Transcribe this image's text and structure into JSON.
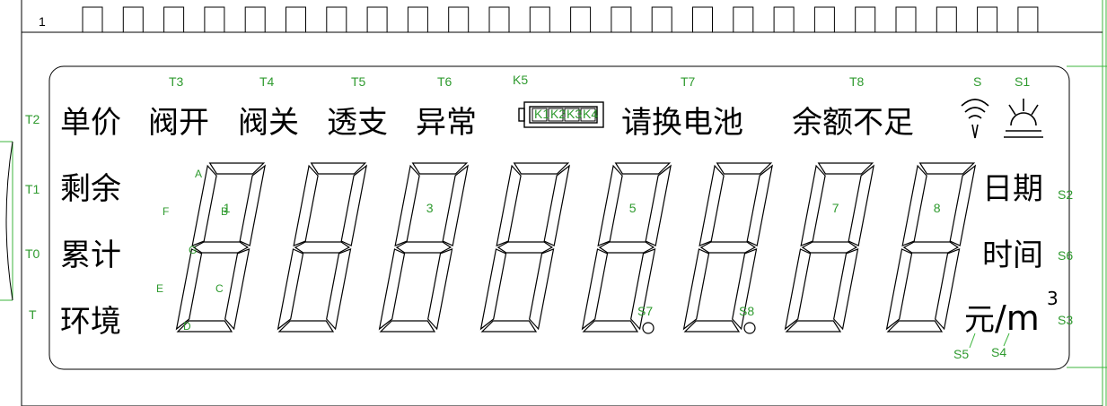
{
  "pin_number": "1",
  "pin_count": 24,
  "colors": {
    "outline": "#000000",
    "label": "#2e9a2e",
    "guide": "#3cb43c"
  },
  "icon_names": [
    "battery-icon",
    "wifi-signal-icon",
    "sunrise-icon",
    "decimal-point-icon"
  ],
  "indicators": {
    "price": "单价",
    "valve_open": "阀开",
    "valve_close": "阀关",
    "overdraft": "透支",
    "abnormal": "异常",
    "replace_battery": "请换电池",
    "low_balance": "余额不足",
    "remaining": "剩余",
    "cumulative": "累计",
    "environment": "环境",
    "date": "日期",
    "time": "时间",
    "unit_yuan": "元",
    "unit_m3": "/m",
    "unit_sup": "3"
  },
  "segment_labels": {
    "T3": "T3",
    "T4": "T4",
    "T5": "T5",
    "T6": "T6",
    "K5": "K5",
    "T7": "T7",
    "T8": "T8",
    "S": "S",
    "S1": "S1",
    "T2": "T2",
    "T1": "T1",
    "T0": "T0",
    "T": "T",
    "S2": "S2",
    "S6": "S6",
    "S3": "S3",
    "S5": "S5",
    "S4": "S4",
    "S7": "S7",
    "S8": "S8",
    "K1": "K1",
    "K2": "K2",
    "K3": "K3",
    "K4": "K4",
    "A": "A",
    "B": "B",
    "C": "C",
    "D": "D",
    "E": "E",
    "F": "F",
    "G": "G"
  },
  "digit_labels": [
    "1",
    "",
    "3",
    "",
    "5",
    "",
    "7",
    "8"
  ]
}
